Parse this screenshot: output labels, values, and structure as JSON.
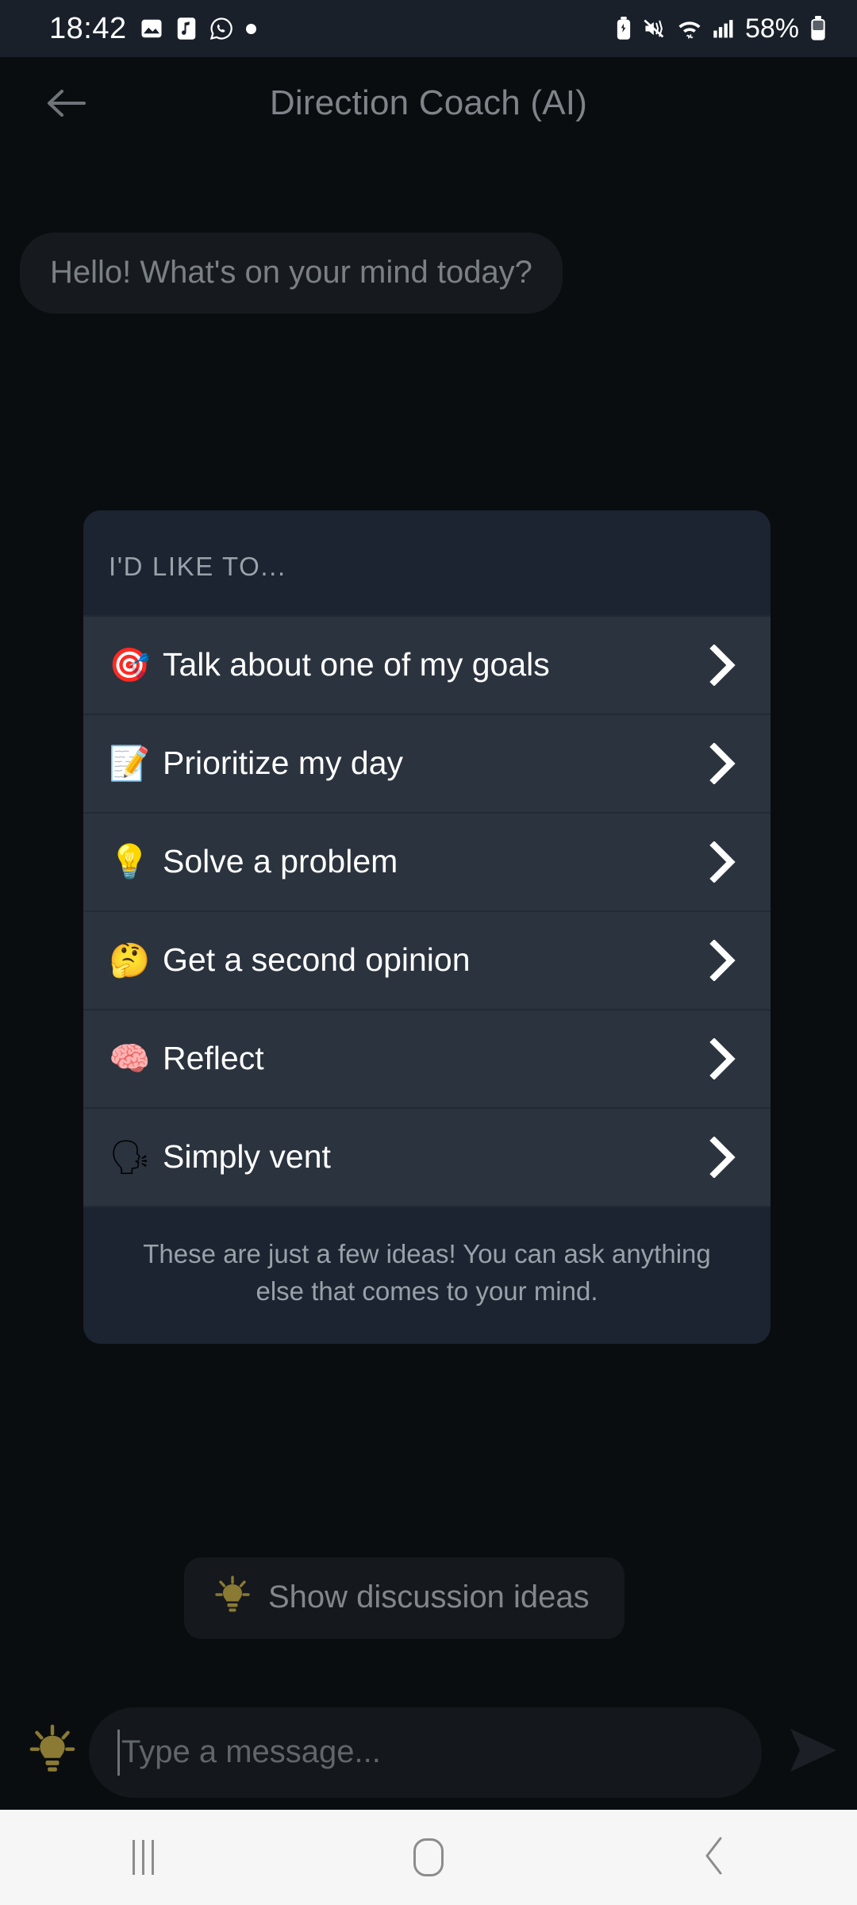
{
  "status_bar": {
    "time": "18:42",
    "left_icons": [
      {
        "name": "gallery-icon",
        "glyph": "🖼"
      },
      {
        "name": "music-icon",
        "glyph": "🎵"
      },
      {
        "name": "whatsapp-icon",
        "glyph": "✆"
      },
      {
        "name": "notification-dot-icon",
        "glyph": "•"
      }
    ],
    "right_icons": [
      {
        "name": "battery-saver-icon",
        "glyph": "♻"
      },
      {
        "name": "mute-vibrate-icon",
        "glyph": "🔇"
      },
      {
        "name": "wifi-icon",
        "glyph": "📶"
      },
      {
        "name": "cellular-signal-icon",
        "glyph": "▂▄▆"
      }
    ],
    "battery_percent": "58%"
  },
  "header": {
    "back_label": "Back",
    "title": "Direction Coach (AI)"
  },
  "conversation": {
    "greeting": "Hello! What's on your mind today?"
  },
  "suggestion_card": {
    "heading": "I'D LIKE TO...",
    "options": [
      {
        "emoji": "🎯",
        "icon_name": "target-emoji",
        "label": "Talk about one of my goals"
      },
      {
        "emoji": "📝",
        "icon_name": "memo-emoji",
        "label": "Prioritize my day"
      },
      {
        "emoji": "💡",
        "icon_name": "lightbulb-emoji",
        "label": "Solve a problem"
      },
      {
        "emoji": "🤔",
        "icon_name": "thinking-face-emoji",
        "label": "Get a second opinion"
      },
      {
        "emoji": "🧠",
        "icon_name": "brain-emoji",
        "label": "Reflect"
      },
      {
        "emoji": "🗣",
        "icon_name": "speaking-head-emoji",
        "label": "Simply vent"
      }
    ],
    "footnote": "These are just a few ideas! You can ask anything else that comes to your mind."
  },
  "ideas_chip": {
    "label": "Show discussion ideas",
    "icon_name": "lightbulb-icon"
  },
  "input_bar": {
    "placeholder": "Type a message...",
    "value": "",
    "bulb_icon_name": "lightbulb-icon",
    "send_icon_name": "send-icon"
  },
  "nav_bar": {
    "recents_label": "Recents",
    "home_label": "Home",
    "back_label": "Back"
  },
  "colors": {
    "status_bar_bg": "#192029",
    "app_bg": "#0a0d10",
    "card_bg": "#1b2430",
    "row_bg": "#2b333e",
    "accent_bulb": "#8a7a33",
    "nav_bg": "#f6f6f6"
  }
}
